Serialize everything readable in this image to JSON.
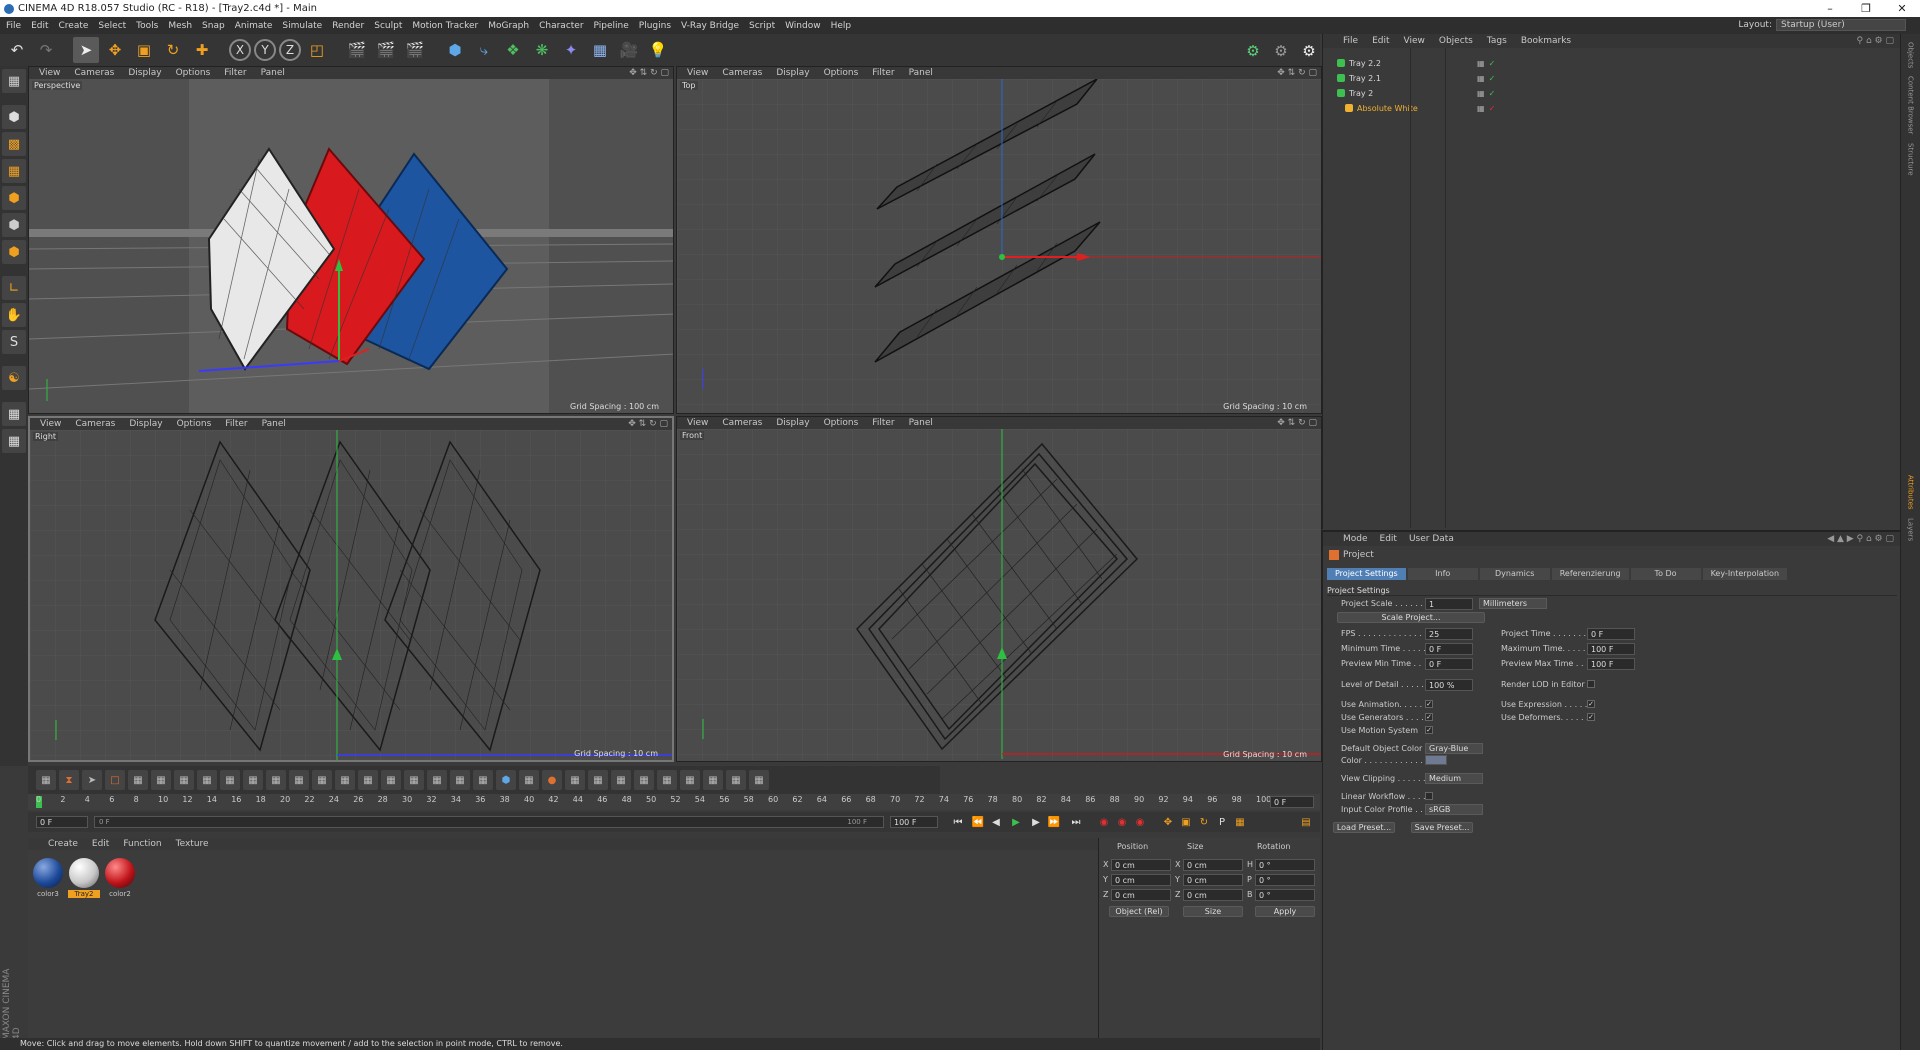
{
  "window": {
    "title": "CINEMA 4D R18.057 Studio (RC - R18) - [Tray2.c4d *] - Main"
  },
  "menu": [
    "File",
    "Edit",
    "Create",
    "Select",
    "Tools",
    "Mesh",
    "Snap",
    "Animate",
    "Simulate",
    "Render",
    "Sculpt",
    "Motion Tracker",
    "MoGraph",
    "Character",
    "Pipeline",
    "Plugins",
    "V-Ray Bridge",
    "Script",
    "Window",
    "Help"
  ],
  "layout": {
    "label": "Layout:",
    "value": "Startup (User)"
  },
  "viewport_menu": [
    "View",
    "Cameras",
    "Display",
    "Options",
    "Filter",
    "Panel"
  ],
  "viewports": [
    {
      "name": "Perspective",
      "grid": "Grid Spacing : 100 cm"
    },
    {
      "name": "Top",
      "grid": "Grid Spacing : 10 cm"
    },
    {
      "name": "Right",
      "grid": "Grid Spacing : 10 cm"
    },
    {
      "name": "Front",
      "grid": "Grid Spacing : 10 cm"
    }
  ],
  "timeline": {
    "ticks": [
      "0",
      "2",
      "4",
      "6",
      "8",
      "10",
      "12",
      "14",
      "16",
      "18",
      "20",
      "22",
      "24",
      "26",
      "28",
      "30",
      "32",
      "34",
      "36",
      "38",
      "40",
      "42",
      "44",
      "46",
      "48",
      "50",
      "52",
      "54",
      "56",
      "58",
      "60",
      "62",
      "64",
      "66",
      "68",
      "70",
      "72",
      "74",
      "76",
      "78",
      "80",
      "82",
      "84",
      "86",
      "88",
      "90",
      "92",
      "94",
      "96",
      "98",
      "100"
    ],
    "current": "0 F",
    "start": "0 F",
    "end": "100 F",
    "end2": "100 F",
    "frame_right": "0 F"
  },
  "material_menu": [
    "Create",
    "Edit",
    "Function",
    "Texture"
  ],
  "materials": [
    {
      "label": "color3",
      "color": "#1d4a9a"
    },
    {
      "label": "Tray2",
      "color": "#dddddd",
      "selected": true
    },
    {
      "label": "color2",
      "color": "#c0141a"
    }
  ],
  "coordinates": {
    "headers": [
      "Position",
      "Size",
      "Rotation"
    ],
    "rows": [
      {
        "axis": "X",
        "pos": "0 cm",
        "saxis": "X",
        "size": "0 cm",
        "raxis": "H",
        "rot": "0 °"
      },
      {
        "axis": "Y",
        "pos": "0 cm",
        "saxis": "Y",
        "size": "0 cm",
        "raxis": "P",
        "rot": "0 °"
      },
      {
        "axis": "Z",
        "pos": "0 cm",
        "saxis": "Z",
        "size": "0 cm",
        "raxis": "B",
        "rot": "0 °"
      }
    ],
    "mode": "Object (Rel)",
    "size_mode": "Size",
    "apply": "Apply"
  },
  "status": "Move: Click and drag to move elements. Hold down SHIFT to quantize movement / add to the selection in point mode, CTRL to remove.",
  "maxon": "MAXON CINEMA 4D",
  "object_menu": [
    "File",
    "Edit",
    "View",
    "Objects",
    "Tags",
    "Bookmarks"
  ],
  "objects": [
    {
      "name": "Tray 2.2",
      "color": "#d8d8d8"
    },
    {
      "name": "Tray 2.1",
      "color": "#d8d8d8"
    },
    {
      "name": "Tray 2",
      "color": "#d8d8d8"
    },
    {
      "name": "Absolute White",
      "color": "#f0b030"
    }
  ],
  "right_tabs": [
    "Objects",
    "Content Browser",
    "Structure",
    "Attributes",
    "Layers"
  ],
  "attr_menu": [
    "Mode",
    "Edit",
    "User Data"
  ],
  "attr": {
    "object": "Project",
    "tabs": [
      "Project Settings",
      "Info",
      "Dynamics",
      "Referenzierung",
      "To Do",
      "Key-Interpolation"
    ],
    "section": "Project Settings",
    "project_scale_label": "Project Scale . . . . . .",
    "project_scale": "1",
    "unit": "Millimeters",
    "scale_btn": "Scale Project...",
    "fps_label": "FPS . . . . . . . . . . . . . .",
    "fps": "25",
    "project_time_label": "Project Time . . . . . . .",
    "project_time": "0 F",
    "min_time_label": "Minimum Time . . . . .",
    "min_time": "0 F",
    "max_time_label": "Maximum Time. . . . . .",
    "max_time": "100 F",
    "prev_min_label": "Preview Min Time . .",
    "prev_min": "0 F",
    "prev_max_label": "Preview Max Time . .",
    "prev_max": "100 F",
    "lod_label": "Level of Detail . . . . .",
    "lod": "100 %",
    "render_lod_label": "Render LOD in Editor",
    "use_anim_label": "Use Animation. . . . . .",
    "use_expr_label": "Use Expression . . . . .",
    "use_gen_label": "Use Generators . . . . .",
    "use_def_label": "Use Deformers. . . . . .",
    "use_motion_label": "Use Motion System",
    "default_color_label": "Default Object Color",
    "default_color": "Gray-Blue",
    "color_label": "Color . . . . . . . . . . . . .",
    "view_clip_label": "View Clipping . . . . . .",
    "view_clip": "Medium",
    "linear_label": "Linear Workflow . . . .",
    "input_color_label": "Input Color Profile . .",
    "input_color": "sRGB",
    "load_preset": "Load Preset...",
    "save_preset": "Save Preset..."
  }
}
